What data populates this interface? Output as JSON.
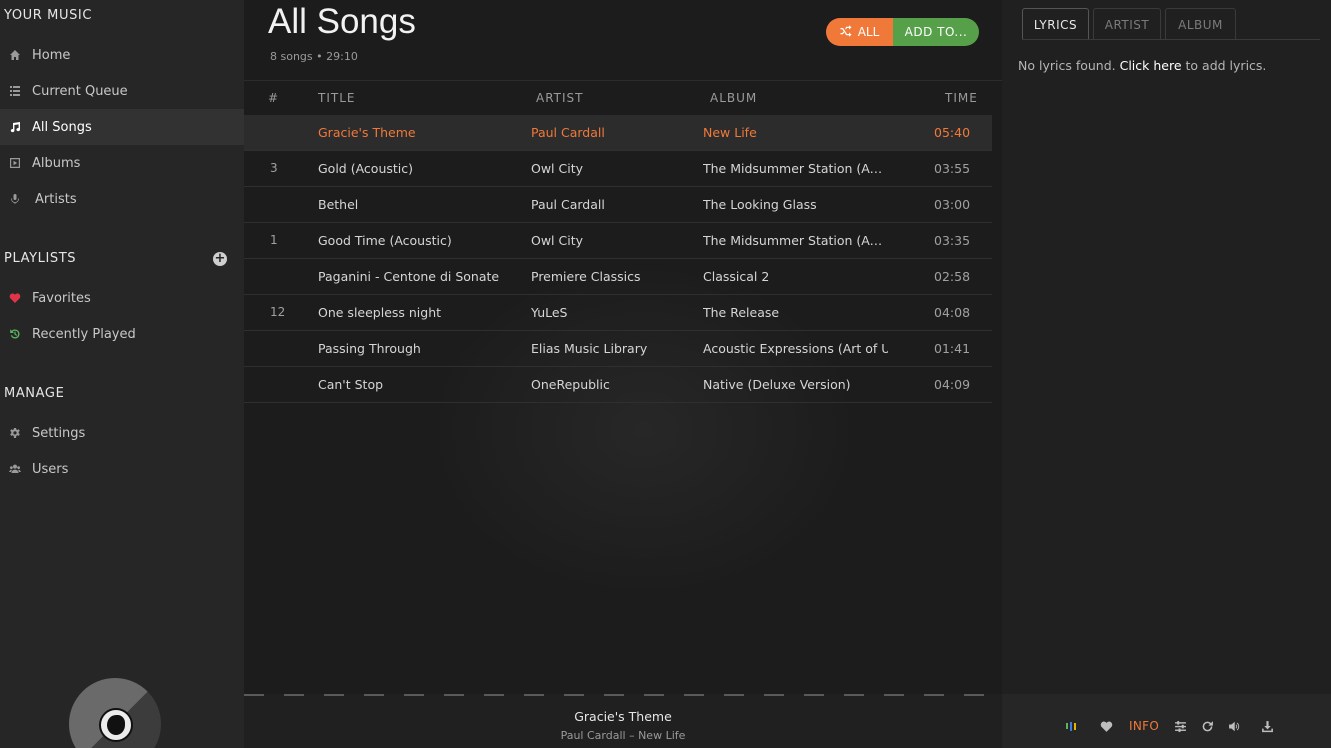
{
  "sidebar": {
    "your_music_heading": "YOUR MUSIC",
    "items": [
      {
        "label": "Home",
        "icon": "home-icon"
      },
      {
        "label": "Current Queue",
        "icon": "list-icon"
      },
      {
        "label": "All Songs",
        "icon": "music-icon"
      },
      {
        "label": "Albums",
        "icon": "album-icon"
      },
      {
        "label": "Artists",
        "icon": "microphone-icon"
      }
    ],
    "playlists_heading": "PLAYLISTS",
    "playlists": [
      {
        "label": "Favorites",
        "icon": "heart-icon"
      },
      {
        "label": "Recently Played",
        "icon": "history-icon"
      }
    ],
    "manage_heading": "MANAGE",
    "manage": [
      {
        "label": "Settings",
        "icon": "gear-icon"
      },
      {
        "label": "Users",
        "icon": "users-icon"
      }
    ]
  },
  "main": {
    "title": "All Songs",
    "meta": "8 songs • 29:10",
    "shuffle_label": "ALL",
    "addto_label": "ADD TO...",
    "columns": {
      "num": "#",
      "title": "TITLE",
      "artist": "ARTIST",
      "album": "ALBUM",
      "time": "TIME"
    },
    "songs": [
      {
        "num": "",
        "title": "Gracie's Theme",
        "artist": "Paul Cardall",
        "album": "New Life",
        "time": "05:40"
      },
      {
        "num": "3",
        "title": "Gold (Acoustic)",
        "artist": "Owl City",
        "album": "The Midsummer Station (Aco…",
        "time": "03:55"
      },
      {
        "num": "",
        "title": "Bethel",
        "artist": "Paul Cardall",
        "album": "The Looking Glass",
        "time": "03:00"
      },
      {
        "num": "1",
        "title": "Good Time (Acoustic)",
        "artist": "Owl City",
        "album": "The Midsummer Station (Aco…",
        "time": "03:35"
      },
      {
        "num": "",
        "title": "Paganini - Centone di Sonate",
        "artist": "Premiere Classics",
        "album": "Classical 2",
        "time": "02:58"
      },
      {
        "num": "12",
        "title": "One sleepless night",
        "artist": "YuLeS",
        "album": "The Release",
        "time": "04:08"
      },
      {
        "num": "",
        "title": "Passing Through",
        "artist": "Elias Music Library",
        "album": "Acoustic Expressions (Art of U",
        "time": "01:41"
      },
      {
        "num": "",
        "title": "Can't Stop",
        "artist": "OneRepublic",
        "album": "Native (Deluxe Version)",
        "time": "04:09"
      }
    ]
  },
  "right": {
    "tabs": [
      "LYRICS",
      "ARTIST",
      "ALBUM"
    ],
    "lyrics_prefix": "No lyrics found.",
    "lyrics_link": "Click here",
    "lyrics_suffix": "to add lyrics."
  },
  "player": {
    "title": "Gracie's Theme",
    "artist": "Paul Cardall",
    "separator": "–",
    "album": "New Life",
    "info_label": "INFO"
  },
  "colors": {
    "accent": "#f0793a",
    "add_green": "#56a04a",
    "favorite_red": "#e0344a",
    "recent_green": "#5bb55f"
  }
}
